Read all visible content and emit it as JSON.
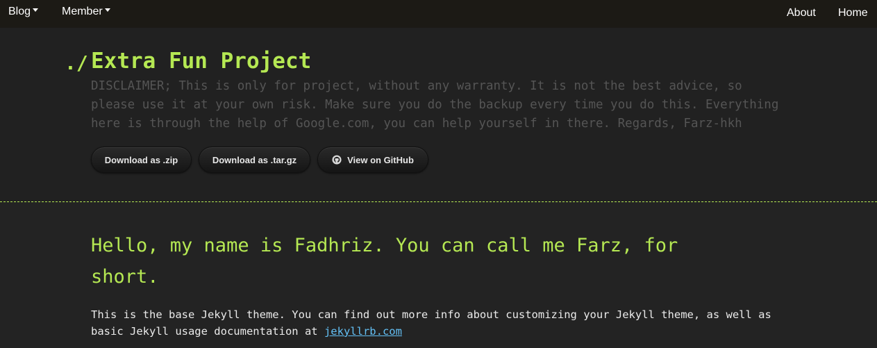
{
  "nav": {
    "blog_label": "Blog",
    "member_label": "Member",
    "about_label": "About",
    "home_label": "Home"
  },
  "header": {
    "title_prefix": "./",
    "title": "Extra Fun Project",
    "disclaimer": "DISCLAIMER; This is only for project, without any warranty. It is not the best advice, so please use it at your own risk. Make sure you do the backup every time you do this. Everything here is through the help of Google.com, you can help yourself in there. Regards, Farz-hkh",
    "buttons": {
      "zip_label": "Download as .zip",
      "tar_label": "Download as .tar.gz",
      "github_label": "View on GitHub"
    }
  },
  "main": {
    "intro": "Hello, my name is Fadhriz. You can call me Farz, for short.",
    "body_text": "This is the base Jekyll theme. You can find out more info about customizing your Jekyll theme, as well as basic Jekyll usage documentation at ",
    "link_text": "jekyllrb.com"
  },
  "colors": {
    "accent": "#b5e853",
    "background": "#232323",
    "link": "#63c0f5",
    "muted": "#555555"
  },
  "icons": {
    "dropdown": "caret-down-icon",
    "github": "github-icon"
  }
}
